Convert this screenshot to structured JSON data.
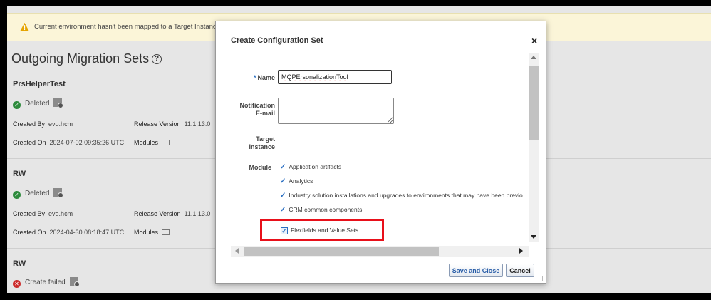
{
  "banner": {
    "message": "Current environment hasn't been mapped to a Target Instance. Go",
    "icon": "warning-icon"
  },
  "page": {
    "title": "Outgoing Migration Sets",
    "rows": [
      {
        "name": "PrsHelperTest",
        "status": "Deleted",
        "created_by_label": "Created By",
        "created_by": "evo.hcm",
        "release_label": "Release Version",
        "release": "11.1.13.0",
        "created_on_label": "Created On",
        "created_on": "2024-07-02 09:35:26 UTC",
        "modules_label": "Modules"
      },
      {
        "name": "RW",
        "status": "Deleted",
        "created_by_label": "Created By",
        "created_by": "evo.hcm",
        "release_label": "Release Version",
        "release": "11.1.13.0",
        "created_on_label": "Created On",
        "created_on": "2024-04-30 08:18:47 UTC",
        "modules_label": "Modules"
      },
      {
        "name": "RW",
        "status": "Create failed"
      }
    ]
  },
  "dialog": {
    "title": "Create Configuration Set",
    "close": "×",
    "name_label": "Name",
    "required_mark": "*",
    "name_value": "MQPErsonalizationTool",
    "email_label_1": "Notification",
    "email_label_2": "E-mail",
    "email_value": "",
    "target_label_1": "Target",
    "target_label_2": "Instance",
    "module_label": "Module",
    "modules": [
      "Application artifacts",
      "Analytics",
      "Industry solution installations and upgrades to environments that may have been previo",
      "CRM common components"
    ],
    "flexfields_label": "Flexfields and Value Sets",
    "flexfields_checked": true,
    "check_mark": "✓",
    "save_label": "Save and Close",
    "cancel_label": "Cancel",
    "highlight_color": "#e8101a"
  }
}
